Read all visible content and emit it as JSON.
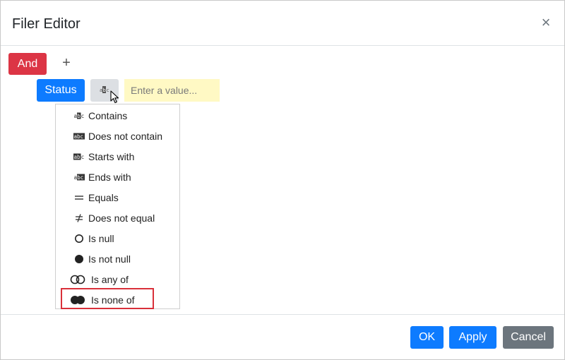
{
  "dialog": {
    "title": "Filer Editor",
    "close_label": "×"
  },
  "filter": {
    "group_operator": "And",
    "add_label": "+",
    "field": "Status",
    "value_placeholder": "Enter a value..."
  },
  "operations_menu": {
    "items": [
      {
        "label": "Contains",
        "icon": "contains-icon"
      },
      {
        "label": "Does not contain",
        "icon": "does-not-contain-icon"
      },
      {
        "label": "Starts with",
        "icon": "starts-with-icon"
      },
      {
        "label": "Ends with",
        "icon": "ends-with-icon"
      },
      {
        "label": "Equals",
        "icon": "equals-icon"
      },
      {
        "label": "Does not equal",
        "icon": "not-equal-icon"
      },
      {
        "label": "Is null",
        "icon": "empty-circle-icon"
      },
      {
        "label": "Is not null",
        "icon": "filled-circle-icon"
      },
      {
        "label": "Is any of",
        "icon": "two-empty-circles-icon"
      },
      {
        "label": "Is none of",
        "icon": "two-filled-circles-icon"
      }
    ],
    "highlighted": "Is none of"
  },
  "footer": {
    "ok_label": "OK",
    "apply_label": "Apply",
    "cancel_label": "Cancel"
  },
  "colors": {
    "and": "#dc3545",
    "primary": "#0d7bff",
    "secondary": "#6c757d",
    "value_bg": "#fff9c4",
    "highlight_border": "#d9303a"
  }
}
